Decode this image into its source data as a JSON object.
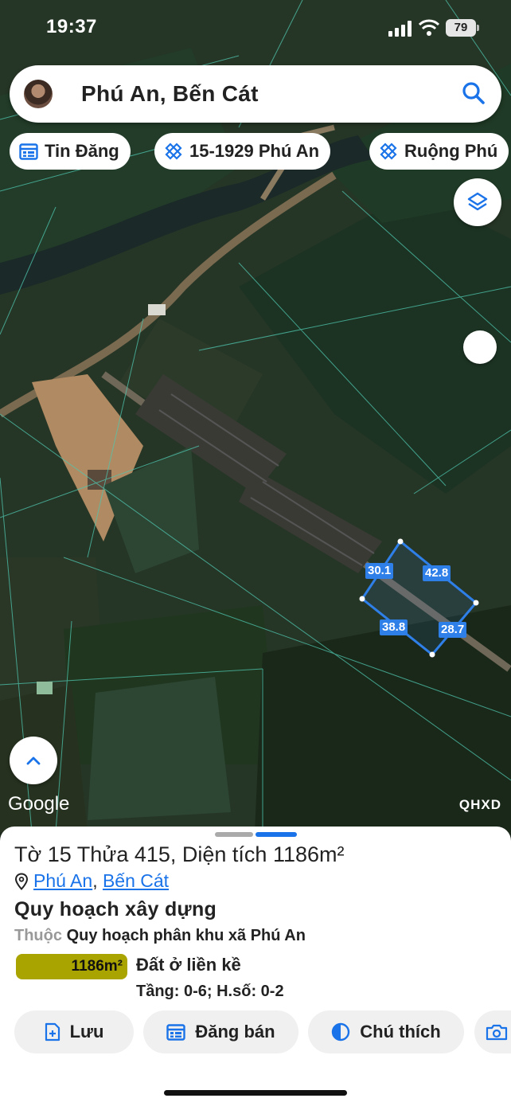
{
  "status_bar": {
    "time": "19:37",
    "battery": "79"
  },
  "search": {
    "query": "Phú An, Bến Cát"
  },
  "chips": [
    {
      "label": "Tin Đăng",
      "icon": "calendar-icon"
    },
    {
      "label": "15-1929 Phú An",
      "icon": "plan-tool-icon"
    },
    {
      "label": "Ruộng Phú",
      "icon": "plan-tool-icon"
    }
  ],
  "map": {
    "attribution": "Google",
    "layer_badge": "QHXD",
    "dimensions": [
      "30.1",
      "42.8",
      "38.8",
      "28.7"
    ]
  },
  "parcel": {
    "title": "Tờ 15 Thửa 415, Diện tích 1186m²",
    "ward": "Phú An",
    "separator": ",",
    "district": "Bến Cát",
    "plan_heading": "Quy hoạch xây dựng",
    "plan_prefix": "Thuộc",
    "plan_name": "Quy hoạch phân khu xã Phú An",
    "area_value": "1186m²",
    "land_use": "Đất ở liền kề",
    "floors": "Tầng: 0-6; H.số: 0-2",
    "area_color": "#a9a400"
  },
  "actions": {
    "save": "Lưu",
    "post": "Đăng bán",
    "legend": "Chú thích"
  },
  "colors": {
    "accent": "#1a73e8",
    "boundary": "#2f7fe8"
  }
}
